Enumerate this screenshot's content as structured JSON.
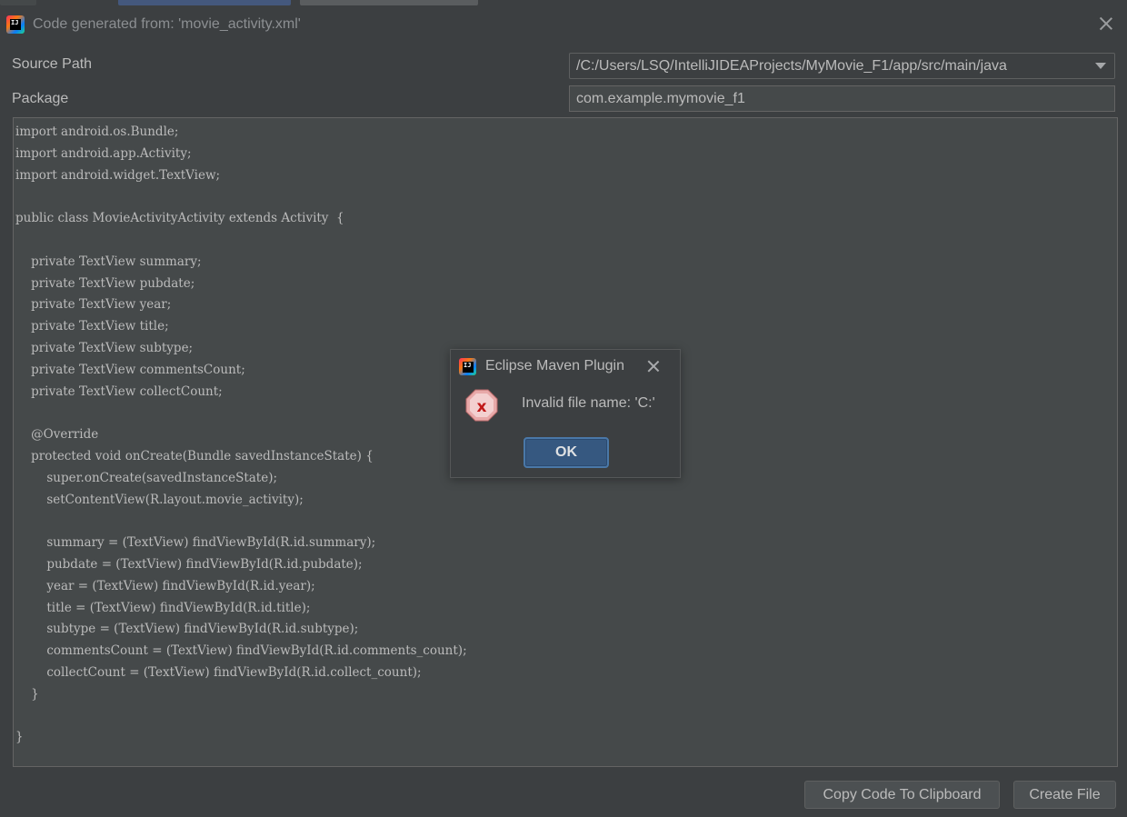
{
  "window": {
    "title": "Code generated from: 'movie_activity.xml'",
    "app_icon_text": "IJ"
  },
  "form": {
    "source_path_label": "Source Path",
    "source_path_value": "/C:/Users/LSQ/IntelliJIDEAProjects/MyMovie_F1/app/src/main/java",
    "package_label": "Package",
    "package_value": "com.example.mymovie_f1"
  },
  "code_lines": [
    "import android.os.Bundle;",
    "import android.app.Activity;",
    "import android.widget.TextView;",
    "",
    "public class MovieActivityActivity extends Activity  {",
    "",
    "    private TextView summary;",
    "    private TextView pubdate;",
    "    private TextView year;",
    "    private TextView title;",
    "    private TextView subtype;",
    "    private TextView commentsCount;",
    "    private TextView collectCount;",
    "",
    "    @Override",
    "    protected void onCreate(Bundle savedInstanceState) {",
    "        super.onCreate(savedInstanceState);",
    "        setContentView(R.layout.movie_activity);",
    "",
    "        summary = (TextView) findViewById(R.id.summary);",
    "        pubdate = (TextView) findViewById(R.id.pubdate);",
    "        year = (TextView) findViewById(R.id.year);",
    "        title = (TextView) findViewById(R.id.title);",
    "        subtype = (TextView) findViewById(R.id.subtype);",
    "        commentsCount = (TextView) findViewById(R.id.comments_count);",
    "        collectCount = (TextView) findViewById(R.id.collect_count);",
    "    }",
    "",
    "}"
  ],
  "buttons": {
    "copy_label": "Copy Code To Clipboard",
    "create_label": "Create File"
  },
  "dialog": {
    "title": "Eclipse Maven Plugin",
    "message": "Invalid file name: 'C:'",
    "ok_label": "OK",
    "icon": "error-icon"
  },
  "colors": {
    "background": "#3c3f41",
    "editor_background": "#45494a",
    "text": "#bbbbbb",
    "ok_button": "#365880",
    "error_red": "#e24a4a"
  }
}
